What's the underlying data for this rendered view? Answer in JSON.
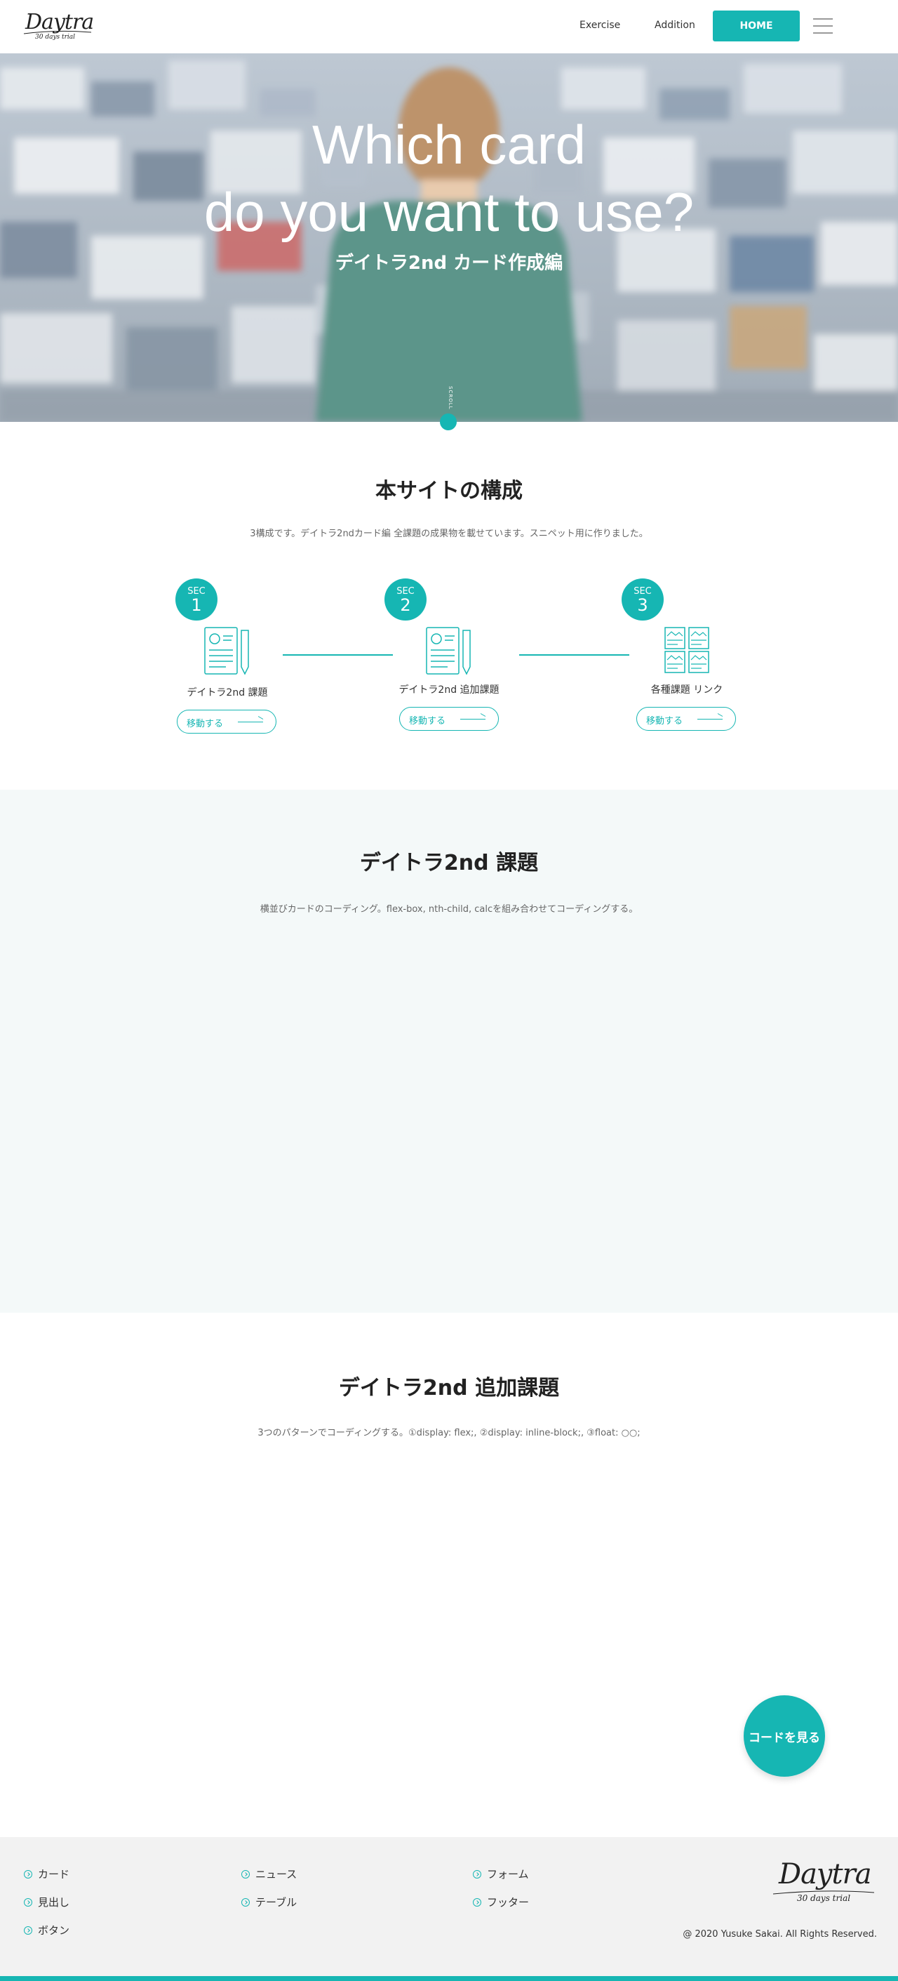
{
  "header": {
    "logo_text": "Daytra",
    "logo_sub": "30 days trial",
    "nav": [
      "Exercise",
      "Addition"
    ],
    "home_label": "HOME"
  },
  "hero": {
    "title_line1": "Which card",
    "title_line2": "do you want to use?",
    "subtitle": "デイトラ2nd カード作成編",
    "scroll_label": "SCROLL"
  },
  "structure": {
    "title": "本サイトの構成",
    "description": "3構成です。デイトラ2ndカード編 全課題の成果物を載せています。スニペット用に作りました。",
    "steps": [
      {
        "sec": "SEC",
        "num": "1",
        "label": "デイトラ2nd 課題",
        "button": "移動する",
        "icon": "profile-card-icon"
      },
      {
        "sec": "SEC",
        "num": "2",
        "label": "デイトラ2nd 追加課題",
        "button": "移動する",
        "icon": "profile-card-icon"
      },
      {
        "sec": "SEC",
        "num": "3",
        "label": "各種課題 リンク",
        "button": "移動する",
        "icon": "card-grid-icon"
      }
    ]
  },
  "assignment": {
    "title": "デイトラ2nd 課題",
    "description": "横並びカードのコーディング。flex-box, nth-child, calcを組み合わせてコーディングする。"
  },
  "additional": {
    "title": "デイトラ2nd 追加課題",
    "description": "3つのパターンでコーディングする。①display: flex;, ②display: inline-block;, ③float: ○○;"
  },
  "code_button": "コードを見る",
  "footer": {
    "col1": [
      "カード",
      "見出し",
      "ボタン"
    ],
    "col2": [
      "ニュース",
      "テーブル"
    ],
    "col3": [
      "フォーム",
      "フッター"
    ],
    "logo_text": "Daytra",
    "logo_sub": "30 days trial",
    "copyright": "@ 2020 Yusuke Sakai. All Rights Reserved."
  },
  "colors": {
    "accent": "#16b6b3",
    "light_band": "#f4f9f9",
    "footer_bg": "#f2f2f2"
  }
}
